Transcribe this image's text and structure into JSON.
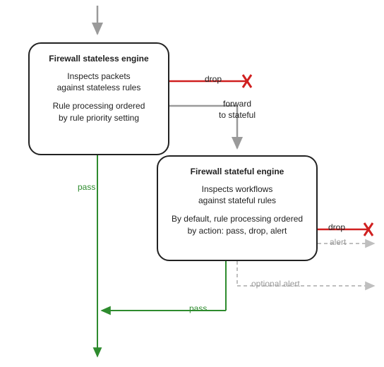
{
  "box1": {
    "title": "Firewall stateless engine",
    "para1_l1": "Inspects packets",
    "para1_l2": "against stateless rules",
    "para2_l1": "Rule processing ordered",
    "para2_l2": "by rule priority setting"
  },
  "box2": {
    "title": "Firewall stateful engine",
    "para1_l1": "Inspects workflows",
    "para1_l2": "against stateful rules",
    "para2_l1": "By default, rule processing ordered",
    "para2_l2": "by action: pass, drop, alert"
  },
  "labels": {
    "drop1": "drop",
    "drop2": "drop",
    "forward_l1": "forward",
    "forward_l2": "to stateful",
    "pass1": "pass",
    "pass2": "pass",
    "alert": "alert",
    "optional_alert": "optional alert"
  },
  "colors": {
    "green": "#2e8b2e",
    "red": "#d02020",
    "gray": "#9a9a9a",
    "line_gray": "#9a9a9a",
    "black": "#222"
  }
}
